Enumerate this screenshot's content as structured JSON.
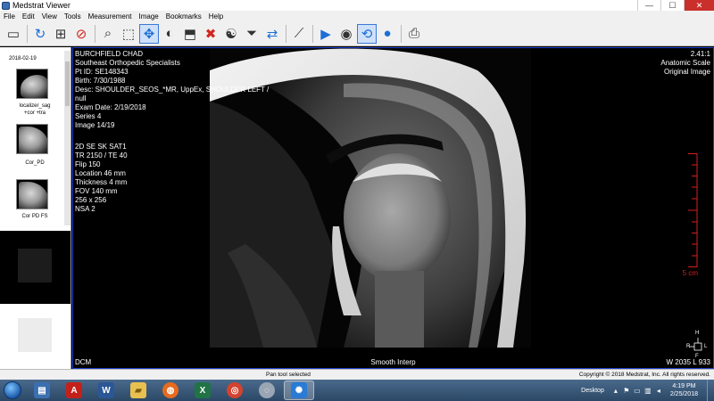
{
  "window": {
    "title": "Medstrat Viewer",
    "controls": [
      "—",
      "☐",
      "✕"
    ]
  },
  "menu": [
    "File",
    "Edit",
    "View",
    "Tools",
    "Measurement",
    "Image",
    "Bookmarks",
    "Help"
  ],
  "toolbar": {
    "tools": [
      {
        "name": "layout-icon",
        "glyph": "▭"
      },
      {
        "name": "rotate-icon",
        "glyph": "↻"
      },
      {
        "name": "grid-layout-icon",
        "glyph": "⊞"
      },
      {
        "name": "stop-icon",
        "glyph": "⊘"
      },
      {
        "name": "magnify-icon",
        "glyph": "⌕"
      },
      {
        "name": "zoom-region-icon",
        "glyph": "⬚"
      },
      {
        "name": "pan-icon",
        "glyph": "✥"
      },
      {
        "name": "contrast-icon",
        "glyph": "◐"
      },
      {
        "name": "crop-icon",
        "glyph": "⬒"
      },
      {
        "name": "delete-icon",
        "glyph": "✖"
      },
      {
        "name": "yin-yang-icon",
        "glyph": "☯"
      },
      {
        "name": "filter-icon",
        "glyph": "⏷"
      },
      {
        "name": "sync-icon",
        "glyph": "⇄"
      },
      {
        "name": "measure-icon",
        "glyph": "⟋"
      },
      {
        "name": "play-icon",
        "glyph": "▶"
      },
      {
        "name": "cine-icon",
        "glyph": "◉"
      },
      {
        "name": "loop-icon",
        "glyph": "⟲"
      },
      {
        "name": "video-icon",
        "glyph": "●"
      },
      {
        "name": "print-icon",
        "glyph": "⎙"
      }
    ]
  },
  "sidebar": {
    "study_date": "2018-02-19",
    "thumbnails": [
      {
        "label": "localizer_sag\n+cor +tra"
      },
      {
        "label": "Cor_PD"
      },
      {
        "label": "Cor PD FS"
      }
    ]
  },
  "overlay": {
    "patient_name": "BURCHFIELD CHAD",
    "institution": "Southeast Orthopedic Specialists",
    "pt_id": "Pt ID: SE148343",
    "birth": "Birth: 7/30/1988",
    "desc": "Desc: SHOULDER_SEOS_*MR, UppEx, SHOULDER LEFT /",
    "desc2": "null",
    "exam_date": "Exam Date: 2/19/2018",
    "series": "Series 4",
    "image": "Image 14/19",
    "sequence": "2D SE SK SAT1",
    "tr_te": "TR 2150 / TE 40",
    "flip": "Flip 150",
    "location": "Location 46 mm",
    "thickness": "Thickness 4 mm",
    "fov": "FOV 140 mm",
    "matrix": "256 x 256",
    "nsa": "NSA 2",
    "zoom": "2.41:1",
    "scale_mode": "Anatomic Scale",
    "original": "Original Image",
    "format": "DCM",
    "interp": "Smooth Interp",
    "window_level": "W 2035 L 933",
    "scale_label": "5 cm",
    "orientation": {
      "top": "H",
      "left": "R",
      "right": "L",
      "bottom": "F"
    },
    "scale_color": "#d32020"
  },
  "status": {
    "message": "Pan tool selected",
    "copyright": "Copyright © 2018 Medstrat, Inc. All rights reserved."
  },
  "taskbar": {
    "apps": [
      {
        "name": "explorer-app-icon",
        "glyph": "▤",
        "color": "#3b6fb0"
      },
      {
        "name": "acrobat-app-icon",
        "glyph": "A",
        "color": "#c4201a"
      },
      {
        "name": "word-app-icon",
        "glyph": "W",
        "color": "#2b5797"
      },
      {
        "name": "folder-app-icon",
        "glyph": "▰",
        "color": "#e8c050"
      },
      {
        "name": "firefox-app-icon",
        "glyph": "◍",
        "color": "#e66b1f"
      },
      {
        "name": "excel-app-icon",
        "glyph": "X",
        "color": "#217346"
      },
      {
        "name": "chrome-app-icon",
        "glyph": "◎",
        "color": "#d4432f"
      },
      {
        "name": "cd-app-icon",
        "glyph": "◌",
        "color": "#9aa6b4"
      },
      {
        "name": "medstrat-app-icon",
        "glyph": "✺",
        "color": "#2a7bd5"
      }
    ],
    "desktop_label": "Desktop",
    "time": "4:19 PM",
    "date": "2/25/2018"
  }
}
